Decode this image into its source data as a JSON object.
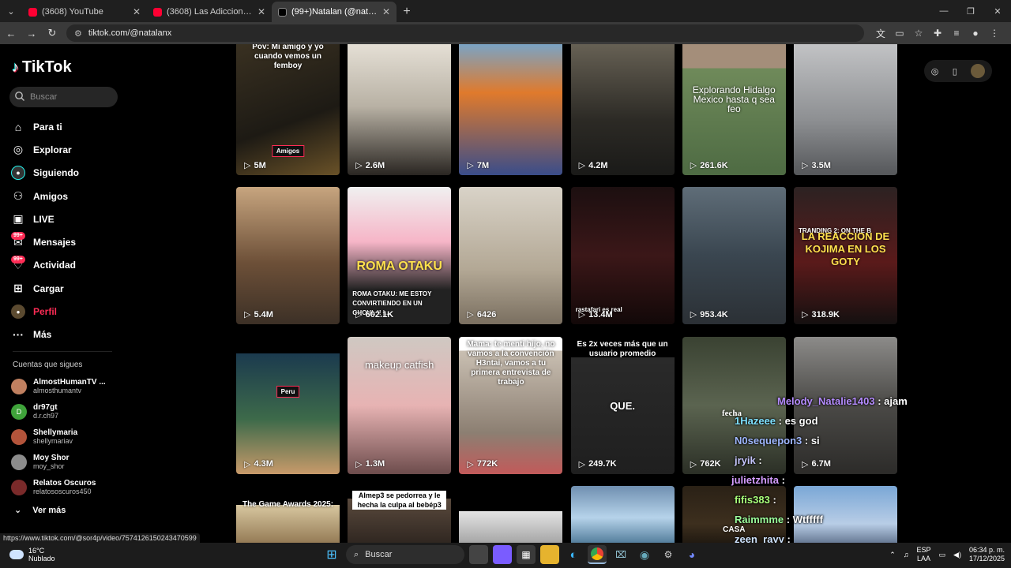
{
  "browser": {
    "tabs": [
      {
        "title": "(3608) YouTube",
        "icon": "youtube-icon",
        "active": false
      },
      {
        "title": "(3608) Las Adicciones más Perturbadoras",
        "icon": "youtube-icon",
        "active": false
      },
      {
        "title": "(99+)Natalan (@natalanx) | TikTok",
        "icon": "tiktok-icon",
        "active": true
      }
    ],
    "url": "tiktok.com/@natalanx",
    "status_url": "https://www.tiktok.com/@sor4p/video/7574126150243470599"
  },
  "sidebar": {
    "logo": "TikTok",
    "search_placeholder": "Buscar",
    "menu": [
      {
        "label": "Para ti",
        "icon": "home-icon"
      },
      {
        "label": "Explorar",
        "icon": "compass-icon"
      },
      {
        "label": "Siguiendo",
        "icon": "following-icon"
      },
      {
        "label": "Amigos",
        "icon": "friends-icon"
      },
      {
        "label": "LIVE",
        "icon": "live-icon"
      },
      {
        "label": "Mensajes",
        "icon": "messages-icon",
        "badge": "99+"
      },
      {
        "label": "Actividad",
        "icon": "activity-icon",
        "badge": "99+"
      },
      {
        "label": "Cargar",
        "icon": "upload-icon"
      },
      {
        "label": "Perfil",
        "icon": "profile-icon",
        "active": true
      },
      {
        "label": "Más",
        "icon": "more-icon"
      }
    ],
    "following_title": "Cuentas que sigues",
    "following": [
      {
        "name": "AlmostHumanTV ...",
        "handle": "almosthumantv"
      },
      {
        "name": "dr97gt",
        "handle": "d.r.ch97",
        "initial": "D"
      },
      {
        "name": "Shellymaria",
        "handle": "shellymariav"
      },
      {
        "name": "Moy Shor",
        "handle": "moy_shor"
      },
      {
        "name": "Relatos Oscuros",
        "handle": "relatososcuros450"
      }
    ],
    "see_more": "Ver más"
  },
  "videos": [
    {
      "views": "5M",
      "caption": "Pov: Mi amigo y yo cuando vemos un femboy",
      "tag": "Amigos"
    },
    {
      "views": "2.6M"
    },
    {
      "views": "7M"
    },
    {
      "views": "4.2M"
    },
    {
      "views": "261.6K",
      "caption": "Explorando Hidalgo Mexico hasta q sea feo"
    },
    {
      "views": "3.5M"
    },
    {
      "views": "5.4M"
    },
    {
      "views": "602.1K",
      "caption": "ROMA OTAKU: ME ESTOY CONVIRTIENDO EN UN GHOUL !! |...",
      "overlay": "ROMA OTAKU"
    },
    {
      "views": "6426"
    },
    {
      "views": "13.4M",
      "caption": "rastafari es real"
    },
    {
      "views": "953.4K"
    },
    {
      "views": "318.9K",
      "overlay": "LA REACCION DE KOJIMA EN LOS GOTY",
      "caption": "TRANDING 2: ON THE B"
    },
    {
      "views": "4.3M",
      "tag": "Peru"
    },
    {
      "views": "1.3M",
      "overlay": "makeup catfish"
    },
    {
      "views": "772K",
      "caption": "Mama: te menti hijo, no vamos a la convención H3ntai, vamos a tu primera entrevista de trabajo"
    },
    {
      "views": "249.7K",
      "caption": "Es 2x veces más que un usuario promedio",
      "overlay": "QUE."
    },
    {
      "views": "762K"
    },
    {
      "views": "6.7M"
    },
    {
      "caption": "The Game Awards 2025:"
    },
    {
      "caption": "Almep3 se pedorrea y le hecha la culpa al bebép3"
    },
    {},
    {},
    {
      "caption": "CASA"
    },
    {}
  ],
  "chat": [
    {
      "user": "Melody_Natalie1403",
      "text": ": ajam"
    },
    {
      "user": "1Hazeee",
      "text": ": es god"
    },
    {
      "user": "N0sequepon3",
      "text": ": si"
    },
    {
      "user": "jryik",
      "text": ":"
    },
    {
      "user": "julietzhita",
      "text": ":"
    },
    {
      "user": "fifis383",
      "text": ":"
    },
    {
      "user": "Raimmme",
      "text": ": Wtfffff"
    },
    {
      "user": "zeen_rayy",
      "text": ":"
    }
  ],
  "chat_label": "fecha",
  "taskbar": {
    "temp": "16°C",
    "weather": "Nublado",
    "search": "Buscar",
    "lang1": "ESP",
    "lang2": "LAA",
    "time": "06:34 p. m.",
    "date": "17/12/2025"
  }
}
